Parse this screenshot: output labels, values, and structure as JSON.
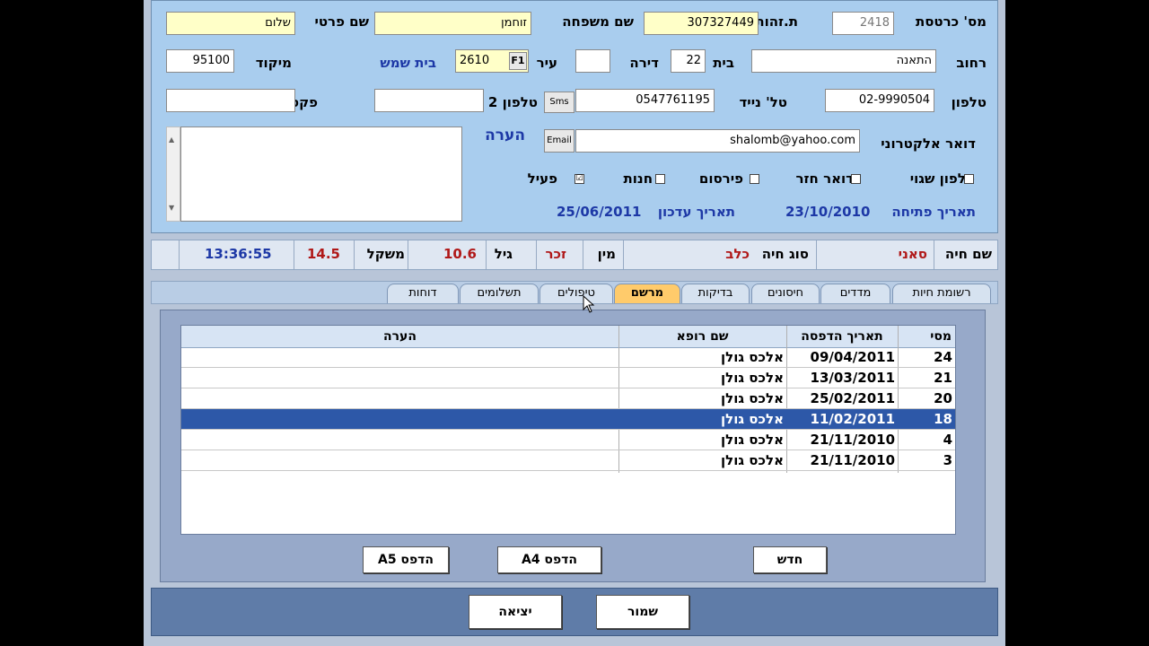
{
  "customer": {
    "card_no_label": "מס' כרטסת",
    "card_no_value": "2418",
    "id_label": "ת.זהות",
    "id_value": "307327449",
    "last_name_label": "שם משפחה",
    "last_name_value": "זוחמן",
    "first_name_label": "שם  פרטי",
    "first_name_value": "שלום",
    "street_label": "רחוב",
    "street_value": "התאנה",
    "house_label": "בית",
    "house_value": "22",
    "apt_label": "דירה",
    "apt_value": "",
    "city_label": "עיר",
    "city_code": "2610",
    "city_f1": "F1",
    "city_name": "בית שמש",
    "zip_label": "מיקוד",
    "zip_value": "95100",
    "phone_label": "טלפון",
    "phone_value": "02-9990504",
    "mobile_label": "טל' נייד",
    "mobile_value": "0547761195",
    "sms_label": "Sms",
    "phone2_label": "טלפון 2",
    "phone2_value": "",
    "fax_label": "פקס",
    "fax_value": "",
    "email_label": "דואר אלקטרוני",
    "email_button": "Email",
    "email_value": "shalomb@yahoo.com",
    "note_label": "הערה",
    "note_value": "",
    "checkboxes": [
      {
        "label": "טלפון שגוי",
        "checked": ""
      },
      {
        "label": "דואר חזר",
        "checked": ""
      },
      {
        "label": "פירסום",
        "checked": ""
      },
      {
        "label": "חנות",
        "checked": ""
      },
      {
        "label": "פעיל",
        "checked": "☑"
      }
    ],
    "open_date_label": "תאריך פתיחה",
    "open_date_value": "23/10/2010",
    "update_date_label": "תאריך עדכון",
    "update_date_value": "25/06/2011"
  },
  "animal": {
    "name_label": "שם חיה",
    "name_value": "סאני",
    "type_label": "סוג חיה",
    "type_value": "כלב",
    "sex_label": "מין",
    "sex_value": "זכר",
    "age_label": "גיל",
    "age_value": "10.6",
    "weight_label": "משקל",
    "weight_value": "14.5",
    "time_value": "13:36:55"
  },
  "tabs": [
    {
      "label": "רשומת חיות"
    },
    {
      "label": "מדדים"
    },
    {
      "label": "חיסונים"
    },
    {
      "label": "בדיקות"
    },
    {
      "label": "מרשם"
    },
    {
      "label": "טיפולים"
    },
    {
      "label": "תשלומים"
    },
    {
      "label": "דוחות"
    }
  ],
  "grid": {
    "headers": {
      "no": "מסי",
      "date": "תאריך הדפסה",
      "doctor": "שם רופא",
      "note": "הערה"
    },
    "rows": [
      {
        "no": "24",
        "date": "09/04/2011",
        "doctor": "אלכס גולן",
        "note": ""
      },
      {
        "no": "21",
        "date": "13/03/2011",
        "doctor": "אלכס גולן",
        "note": ""
      },
      {
        "no": "20",
        "date": "25/02/2011",
        "doctor": "אלכס גולן",
        "note": ""
      },
      {
        "no": "18",
        "date": "11/02/2011",
        "doctor": "אלכס גולן",
        "note": ""
      },
      {
        "no": "4",
        "date": "21/11/2010",
        "doctor": "אלכס גולן",
        "note": ""
      },
      {
        "no": "3",
        "date": "21/11/2010",
        "doctor": "אלכס גולן",
        "note": ""
      }
    ]
  },
  "buttons": {
    "new": "חדש",
    "print_a4": "הדפס A4",
    "print_a5": "הדפס A5",
    "save": "שמור",
    "exit": "יציאה"
  }
}
